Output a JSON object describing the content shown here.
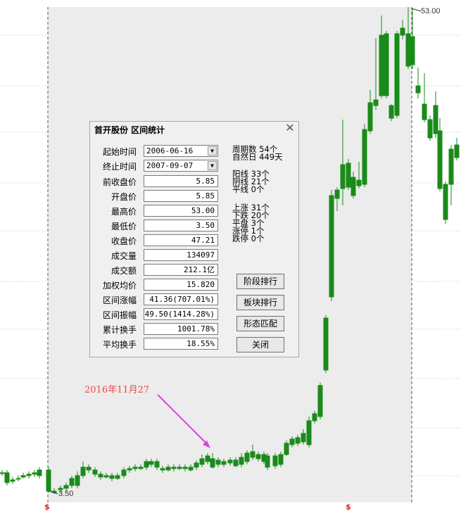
{
  "chart_data": {
    "type": "candlestick",
    "high_label": "53.00",
    "low_label": "3.50",
    "annotation": "2016年11月27",
    "axis_marker_left": "$",
    "axis_marker_right": "$",
    "colors": {
      "up": "#e02020",
      "down": "#1a8a1a",
      "annotation": "#f0464a",
      "arrow": "#e040e0",
      "range_shade": "#ececec"
    },
    "ylim": [
      0,
      57
    ]
  },
  "dialog": {
    "title": "首开股份 区间统计",
    "close_icon": "close-icon",
    "start_label": "起始时间",
    "start_value": "2006-06-16",
    "end_label": "终止时间",
    "end_value": "2007-09-07",
    "fields": [
      {
        "label": "前收盘价",
        "value": "5.85"
      },
      {
        "label": "开盘价",
        "value": "5.85"
      },
      {
        "label": "最高价",
        "value": "53.00"
      },
      {
        "label": "最低价",
        "value": "3.50"
      },
      {
        "label": "收盘价",
        "value": "47.21"
      },
      {
        "label": "成交量",
        "value": "134097"
      },
      {
        "label": "成交额",
        "value": "212.1亿"
      },
      {
        "label": "加权均价",
        "value": "15.820"
      },
      {
        "label": "区间涨幅",
        "value": "41.36(707.01%)"
      },
      {
        "label": "区间振幅",
        "value": "49.50(1414.28%)"
      },
      {
        "label": "累计换手",
        "value": "1001.78%"
      },
      {
        "label": "平均换手",
        "value": "18.55%"
      }
    ],
    "stats": {
      "period_count": "周期数 54个",
      "natural_days": "自然日 449天",
      "yang": "阳线 33个",
      "yin": "阴线 21个",
      "flat": "平线 0个",
      "rise": "上涨 31个",
      "fall": "下跌 20个",
      "level": "平盘 3个",
      "limit_up": "涨停 1个",
      "limit_down": "跌停 0个"
    },
    "buttons": {
      "stage_rank": "阶段排行",
      "sector_rank": "板块排行",
      "pattern_match": "形态匹配",
      "close": "关闭"
    }
  }
}
